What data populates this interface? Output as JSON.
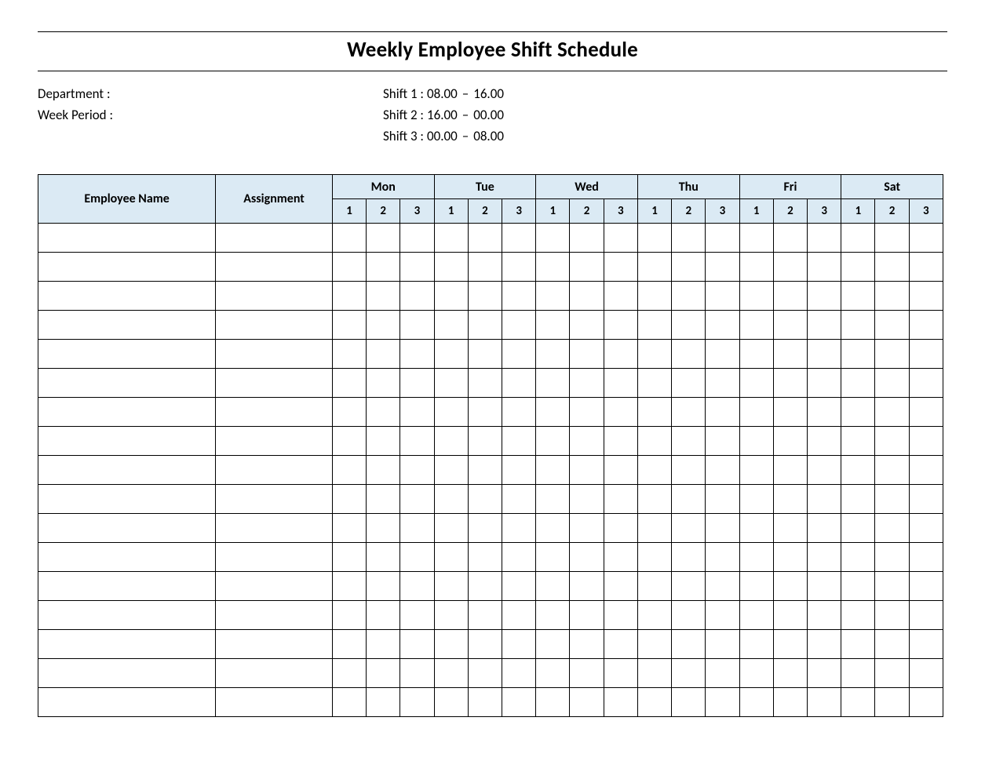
{
  "title": "Weekly Employee Shift Schedule",
  "meta": {
    "department_label": "Department    :",
    "week_period_label": "Week  Period :"
  },
  "shifts": [
    {
      "label": "Shift 1  :",
      "start": "08.00",
      "sep": "–",
      "end": "16.00"
    },
    {
      "label": "Shift 2  :",
      "start": "16.00",
      "sep": "–",
      "end": "00.00"
    },
    {
      "label": "Shift 3  :",
      "start": "00.00",
      "sep": "–",
      "end": "08.00"
    }
  ],
  "headers": {
    "employee": "Employee Name",
    "assignment": "Assignment",
    "days": [
      "Mon",
      "Tue",
      "Wed",
      "Thu",
      "Fri",
      "Sat"
    ],
    "sub": [
      "1",
      "2",
      "3"
    ]
  },
  "rows": 17
}
